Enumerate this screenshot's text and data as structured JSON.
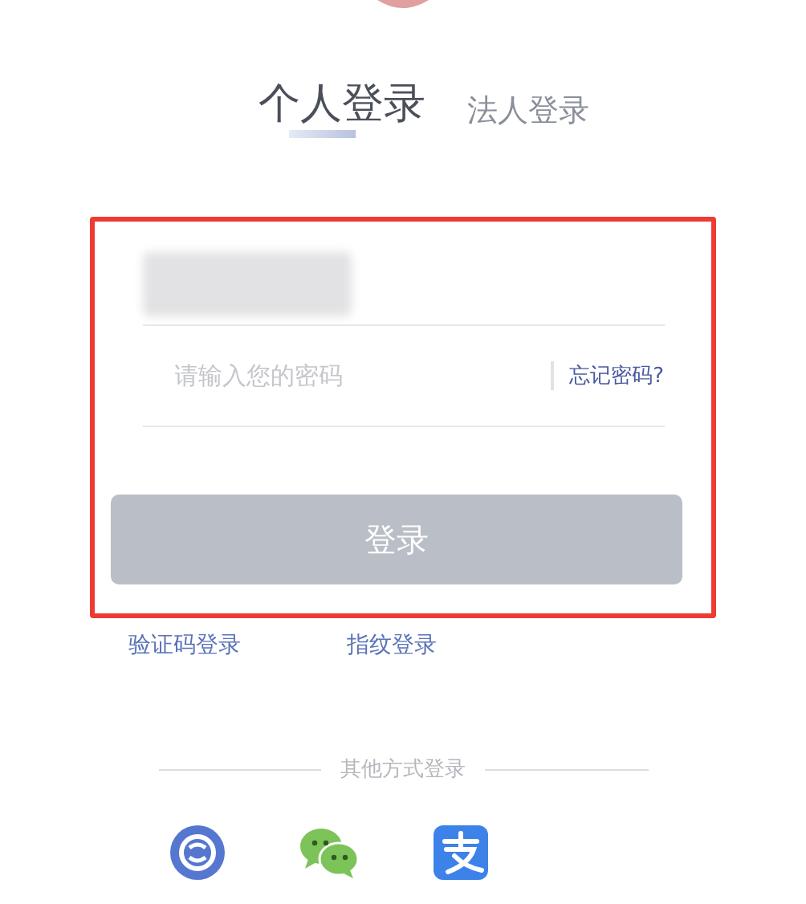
{
  "tabs": [
    {
      "label": "个人登录",
      "selected": true
    },
    {
      "label": "法人登录",
      "selected": false
    }
  ],
  "form": {
    "password_placeholder": "请输入您的密码",
    "forgot_link": "忘记密码?",
    "login_button": "登录"
  },
  "alt_links": [
    "验证码登录",
    "指纹登录"
  ],
  "other_methods": {
    "label": "其他方式登录",
    "icons": [
      {
        "kind": "social-security"
      },
      {
        "kind": "chat"
      },
      {
        "kind": "payment"
      }
    ]
  }
}
